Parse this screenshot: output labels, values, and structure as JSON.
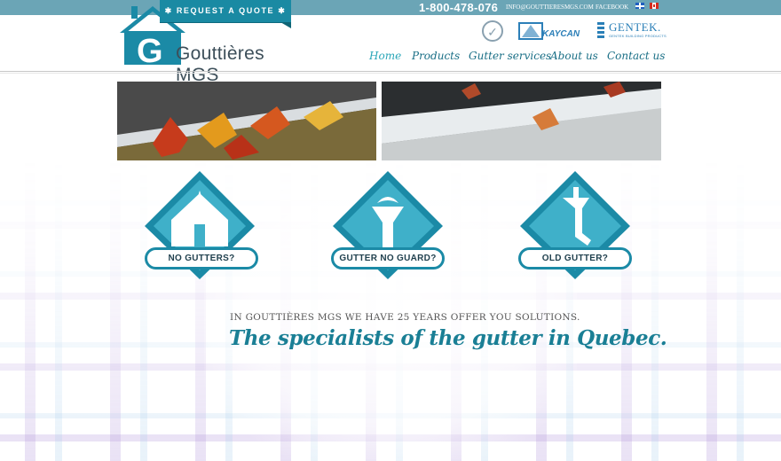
{
  "header": {
    "phone": "1-800-478-076",
    "email": "INFO@GOUTTIERESMGS.COM",
    "facebook": "FACEBOOK",
    "quote_button": "✱ REQUEST A QUOTE ✱"
  },
  "logo": {
    "text": "Gouttières MGS"
  },
  "partners": {
    "kaycan": "KAYCAN",
    "gentek": "GENTEK.",
    "gentek_sub": "GENTEK BUILDING PRODUCTS"
  },
  "nav": {
    "items": [
      {
        "label": "Home",
        "active": true
      },
      {
        "label": "Products",
        "active": false
      },
      {
        "label": "Gutter services",
        "active": false
      },
      {
        "label": "About us",
        "active": false
      },
      {
        "label": "Contact us",
        "active": false
      }
    ]
  },
  "services": [
    {
      "label": "NO GUTTERS?",
      "icon": "house-rain-icon"
    },
    {
      "label": "GUTTER NO GUARD?",
      "icon": "leaf-funnel-icon"
    },
    {
      "label": "OLD GUTTER?",
      "icon": "downspout-icon"
    }
  ],
  "tagline": {
    "line1": "In Gouttières MGS we have 25 years offer you solutions.",
    "line2": "The specialists of the gutter in Quebec."
  },
  "colors": {
    "accent": "#1a8aa3",
    "topbar": "#6ba5b6",
    "nav_text": "#1a6f86",
    "tagline": "#1a7f95"
  }
}
